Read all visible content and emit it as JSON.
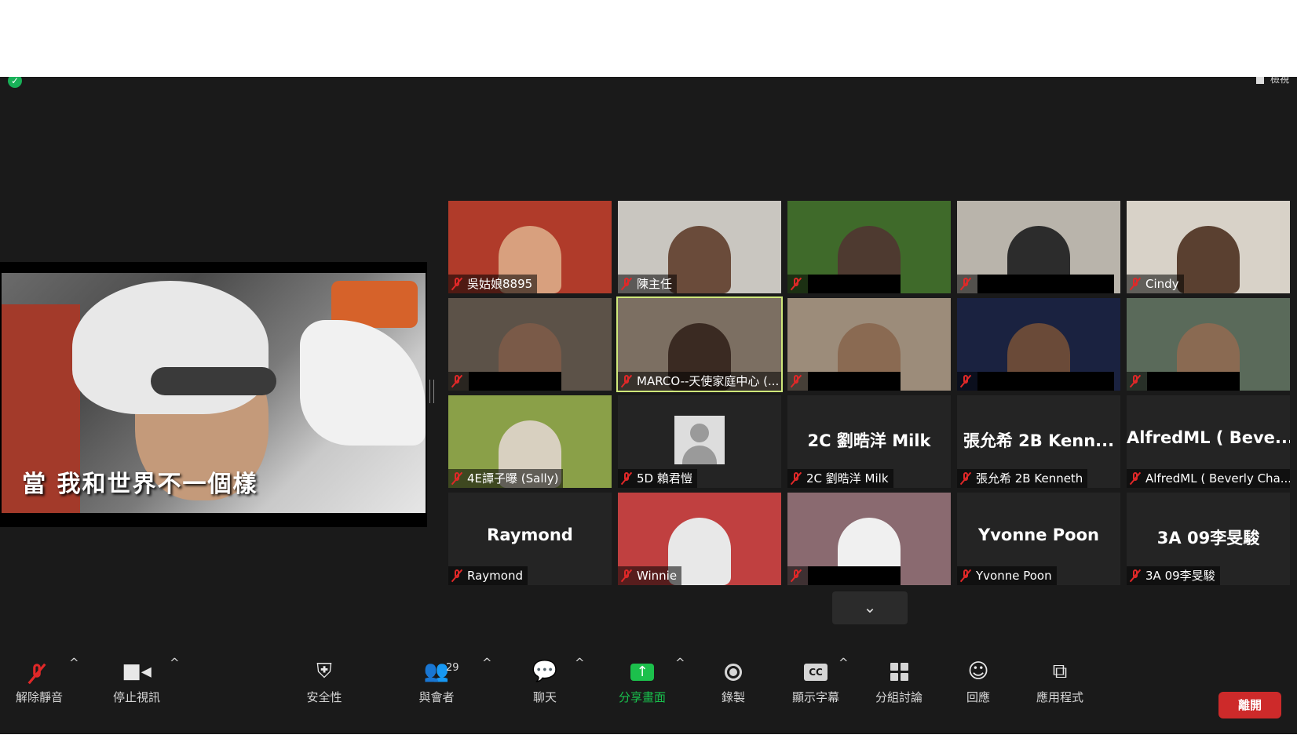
{
  "header": {
    "view_label": "檢視"
  },
  "share": {
    "subtitle": "當 我和世界不一個樣"
  },
  "tiles": [
    {
      "label": "吳姑娘8895",
      "bg": "#b03b2a",
      "person": "#d8a07e"
    },
    {
      "label": "陳主任",
      "bg": "#c9c6c0",
      "person": "#6a4b3a"
    },
    {
      "label": "",
      "bg": "#3f6a2a",
      "person": "#4e3a30"
    },
    {
      "label": "",
      "bg": "#b9b4ab",
      "person": "#2c2c2c"
    },
    {
      "label": "Cindy",
      "bg": "#d8d2c8",
      "person": "#5a4030"
    },
    {
      "label": "",
      "bg": "#5c5248",
      "person": "#7a5a48"
    },
    {
      "label": "MARCO--天使家庭中心 (...",
      "bg": "#7c6f62",
      "person": "#3a2a22"
    },
    {
      "label": "",
      "bg": "#9c8c7a",
      "person": "#8a6a52"
    },
    {
      "label": "",
      "bg": "#1a2240",
      "person": "#6a4a38"
    },
    {
      "label": "",
      "bg": "#5a6a5a",
      "person": "#8a6a52"
    },
    {
      "label": "4E譚子曝 (Sally)",
      "bg": "#8aa048",
      "person": "#d8d0c0"
    },
    {
      "label": "5D 賴君愷",
      "bg": "#242424",
      "avatar": true
    },
    {
      "label": "2C 劉晧洋 Milk",
      "big": "2C 劉晧洋 Milk"
    },
    {
      "label": "張允希 2B Kenneth",
      "big": "張允希 2B Kenn..."
    },
    {
      "label": "AlfredML ( Beverly Cha...",
      "big": "AlfredML ( Beve..."
    },
    {
      "label": "Raymond",
      "big": "Raymond"
    },
    {
      "label": "Winnie",
      "bg": "#c04040",
      "person": "#e8e8e8"
    },
    {
      "label": "",
      "bg": "#8a6a70",
      "person": "#f0f0f0"
    },
    {
      "label": "Yvonne Poon",
      "big": "Yvonne Poon"
    },
    {
      "label": "3A 09李旻駿",
      "big": "3A 09李旻駿"
    }
  ],
  "toolbar": {
    "unmute": "解除靜音",
    "stop_video": "停止視訊",
    "security": "安全性",
    "participants": "與會者",
    "participant_count": "29",
    "chat": "聊天",
    "share_screen": "分享畫面",
    "record": "錄製",
    "captions": "顯示字幕",
    "captions_icon": "CC",
    "breakout": "分組討論",
    "reactions": "回應",
    "apps": "應用程式",
    "leave": "離開"
  },
  "colors": {
    "leave": "#cd2a2a",
    "share": "#1cc04c",
    "active_border": "#cfe87a"
  }
}
